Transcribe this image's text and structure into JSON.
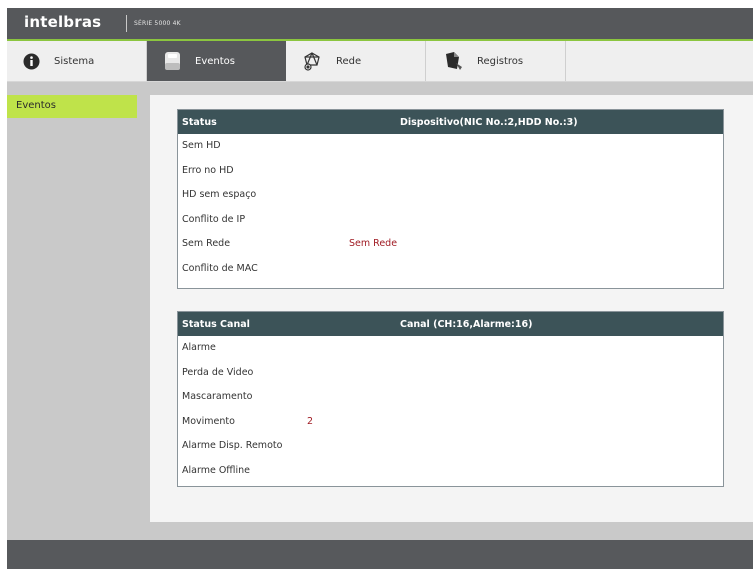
{
  "header": {
    "logo": "intelbras",
    "series": "SÉRIE 5000 4K"
  },
  "tabs": [
    {
      "label": "Sistema",
      "icon": "info-icon"
    },
    {
      "label": "Eventos",
      "icon": "hard-drive-icon",
      "active": true
    },
    {
      "label": "Rede",
      "icon": "network-icon"
    },
    {
      "label": "Registros",
      "icon": "document-icon"
    }
  ],
  "sidebar": {
    "items": [
      {
        "label": "Eventos",
        "selected": true
      }
    ]
  },
  "device_status": {
    "header_left": "Status",
    "header_right": "Dispositivo(NIC No.:2,HDD No.:3)",
    "rows": [
      {
        "label": "Sem HD",
        "value": ""
      },
      {
        "label": "Erro no HD",
        "value": ""
      },
      {
        "label": "HD sem espaço",
        "value": ""
      },
      {
        "label": "Conflito de IP",
        "value": ""
      },
      {
        "label": "Sem Rede",
        "value": "Sem Rede"
      },
      {
        "label": "Conflito de MAC",
        "value": ""
      }
    ]
  },
  "channel_status": {
    "header_left": "Status Canal",
    "header_right": "Canal (CH:16,Alarme:16)",
    "rows": [
      {
        "label": "Alarme",
        "value": ""
      },
      {
        "label": "Perda de Video",
        "value": ""
      },
      {
        "label": "Mascaramento",
        "value": ""
      },
      {
        "label": "Movimento",
        "value": "2"
      },
      {
        "label": "Alarme Disp. Remoto",
        "value": ""
      },
      {
        "label": "Alarme Offline",
        "value": ""
      }
    ]
  },
  "colors": {
    "accent_green": "#bfe34a",
    "header_dark": "#56585b",
    "panel_header": "#3c5358",
    "alert_red": "#a01c24"
  }
}
